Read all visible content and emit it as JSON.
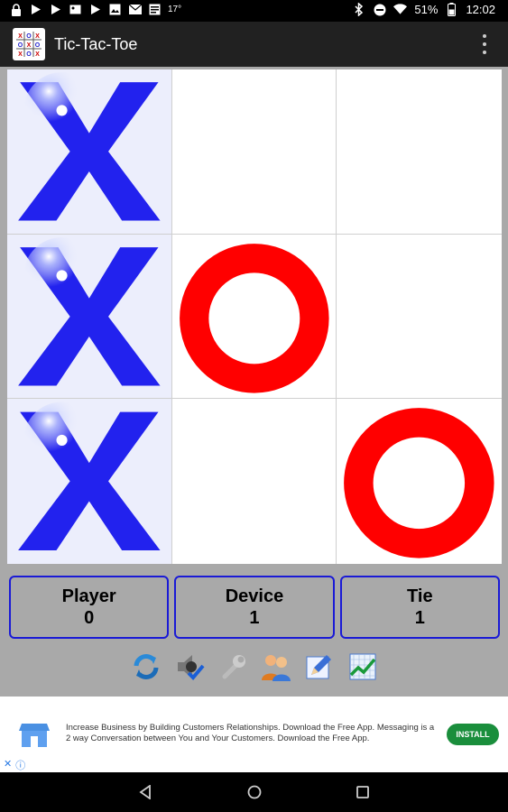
{
  "status_bar": {
    "temperature": "17°",
    "battery": "51%",
    "time": "12:02"
  },
  "app": {
    "title": "Tic-Tac-Toe",
    "icon": "tic-tac-toe-app-icon"
  },
  "board": {
    "cells": [
      "X",
      "",
      "",
      "X",
      "O",
      "",
      "X",
      "",
      "O"
    ],
    "colors": {
      "x": "#2222ee",
      "o": "#ff0000"
    }
  },
  "scores": [
    {
      "label": "Player",
      "value": "0"
    },
    {
      "label": "Device",
      "value": "1"
    },
    {
      "label": "Tie",
      "value": "1"
    }
  ],
  "toolbar": {
    "icons": [
      "refresh-icon",
      "sound-icon",
      "wrench-icon",
      "players-icon",
      "edit-icon",
      "stats-icon"
    ]
  },
  "ad": {
    "text": "Increase Business by Building Customers Relationships. Download the Free App. Messaging is a 2 way Conversation between You and Your Customers. Download the Free App.",
    "button": "INSTALL",
    "install_color": "#1a8e3c"
  }
}
